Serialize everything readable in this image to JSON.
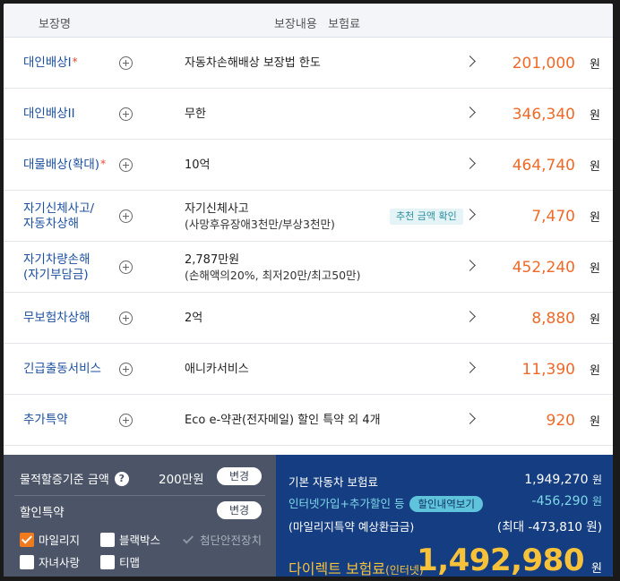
{
  "header": {
    "col_name": "보장명",
    "col_content": "보장내용   보험료"
  },
  "rows": [
    {
      "name": "대인배상I",
      "required": "*",
      "desc": "자동차손해배상 보장법 한도",
      "sub": "",
      "tag": "",
      "amount": "201,000",
      "unit": "원"
    },
    {
      "name": "대인배상II",
      "required": "",
      "desc": "무한",
      "sub": "",
      "tag": "",
      "amount": "346,340",
      "unit": "원"
    },
    {
      "name": "대물배상(확대)",
      "required": "*",
      "desc": "10억",
      "sub": "",
      "tag": "",
      "amount": "464,740",
      "unit": "원"
    },
    {
      "name": "자기신체사고/\n자동차상해",
      "required": "",
      "desc": "자기신체사고",
      "sub": "(사망후유장애3천만/부상3천만)",
      "tag": "추천 금액 확인",
      "amount": "7,470",
      "unit": "원"
    },
    {
      "name": "자기차량손해\n(자기부담금)",
      "required": "",
      "desc": "2,787만원",
      "sub": "(손해액의20%, 최저20만/최고50만)",
      "tag": "",
      "amount": "452,240",
      "unit": "원"
    },
    {
      "name": "무보험차상해",
      "required": "",
      "desc": "2억",
      "sub": "",
      "tag": "",
      "amount": "8,880",
      "unit": "원"
    },
    {
      "name": "긴급출동서비스",
      "required": "",
      "desc": "애니카서비스",
      "sub": "",
      "tag": "",
      "amount": "11,390",
      "unit": "원"
    },
    {
      "name": "추가특약",
      "required": "",
      "desc": "Eco e-약관(전자메일) 할인 특약 외 4개",
      "sub": "",
      "tag": "",
      "amount": "920",
      "unit": "원"
    }
  ],
  "left": {
    "property_label": "물적할증기준 금액",
    "property_value": "200만원",
    "change_label": "변경",
    "discount_label": "할인특약",
    "change_label2": "변경",
    "options": [
      {
        "label": "마일리지",
        "checked": true
      },
      {
        "label": "블랙박스",
        "checked": false
      },
      {
        "label": "첨단안전장치",
        "checked": true,
        "disabled": true
      },
      {
        "label": "자녀사랑",
        "checked": false
      },
      {
        "label": "티맵",
        "checked": false
      }
    ]
  },
  "right": {
    "base_label": "기본 자동차 보험료",
    "base_value": "1,949,270",
    "base_unit": "원",
    "disc_label": "인터넷가입+추가할인 등",
    "disc_pill": "할인내역보기",
    "disc_value": "-456,290",
    "disc_unit": "원",
    "mileage_label": "(마일리지특약 예상환급금)",
    "mileage_value": "(최대 -473,810 원)",
    "total_label": "다이렉트 보험료",
    "total_sub": "(인터넷)",
    "total_value": "1,492,980",
    "total_unit": "원"
  },
  "colors": {
    "accent_orange": "#ef6a28",
    "name_blue": "#1b4fa0",
    "panel_navy": "#153e82",
    "panel_slate": "#4b5567",
    "total_gold": "#f7c23a"
  }
}
